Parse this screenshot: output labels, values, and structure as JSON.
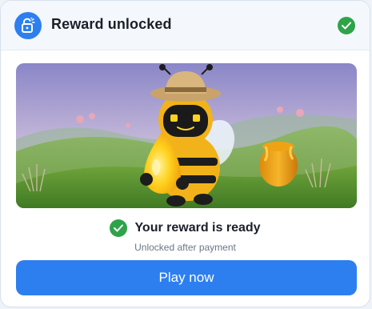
{
  "header": {
    "title": "Reward unlocked",
    "lock_icon": "unlocked-padlock-icon",
    "status_icon": "check-circle-icon"
  },
  "status": {
    "icon": "check-circle-icon",
    "text": "Your reward is ready",
    "subtext": "Unlocked after payment"
  },
  "action": {
    "label": "Play now"
  },
  "colors": {
    "accent": "#2d7ff0",
    "success": "#2fa34a",
    "header_bg": "#f4f8fc"
  }
}
